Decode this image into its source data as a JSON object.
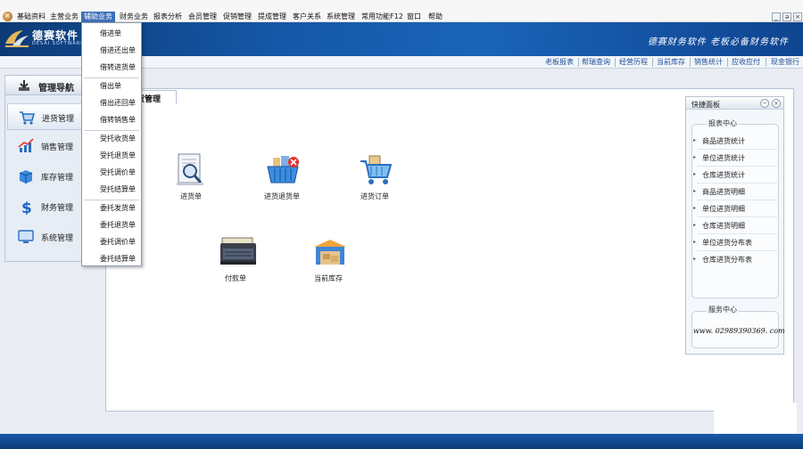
{
  "menubar": {
    "items": [
      "基础资料",
      "主营业务",
      "辅助业务",
      "财务业务",
      "报表分析",
      "会员管理",
      "促销管理",
      "提成管理",
      "客户关系",
      "系统管理",
      "常用功能F12",
      "窗口",
      "帮助"
    ],
    "active_index": 2,
    "window_controls": [
      "_",
      "ə",
      "×"
    ]
  },
  "banner": {
    "logo_text": "德赛软件",
    "logo_sub": "DESAI SOFTWARE",
    "slogan": "德赛财务软件 老板必备财务软件"
  },
  "quicklinks": [
    "老板报表",
    "帮瑞查询",
    "经营历程",
    "当前库存",
    "销售统计",
    "应收应付",
    "现金银行"
  ],
  "nav": {
    "header": "管理导航",
    "items": [
      "进货管理",
      "销售管理",
      "库存管理",
      "财务管理",
      "系统管理"
    ],
    "active_index": 0
  },
  "main": {
    "tab_label": "货管理",
    "tiles": [
      "进货单",
      "进货退货单",
      "进货订单",
      "付款单",
      "当前库存"
    ]
  },
  "dropdown": {
    "items": [
      "借进单",
      "借进还出单",
      "借转进货单",
      "借出单",
      "借出还回单",
      "借转销售单",
      "受托收货单",
      "受托退货单",
      "受托调价单",
      "受托结算单",
      "委托发货单",
      "委托退货单",
      "委托调价单",
      "委托结算单"
    ]
  },
  "quick_panel": {
    "title": "快捷面板",
    "controls": [
      "−",
      "×"
    ],
    "report_title": "报表中心",
    "reports": [
      "商品进货统计",
      "单位进货统计",
      "仓库进货统计",
      "商品进货明细",
      "单位进货明细",
      "仓库进货明细",
      "单位进货分布表",
      "仓库进货分布表"
    ],
    "service_title": "服务中心",
    "service_phone": "www. 02989390369. com"
  },
  "colors": {
    "banner_blue": "#1558a8",
    "menu_active": "#3c6fb8",
    "link_blue": "#1d4f9c"
  }
}
